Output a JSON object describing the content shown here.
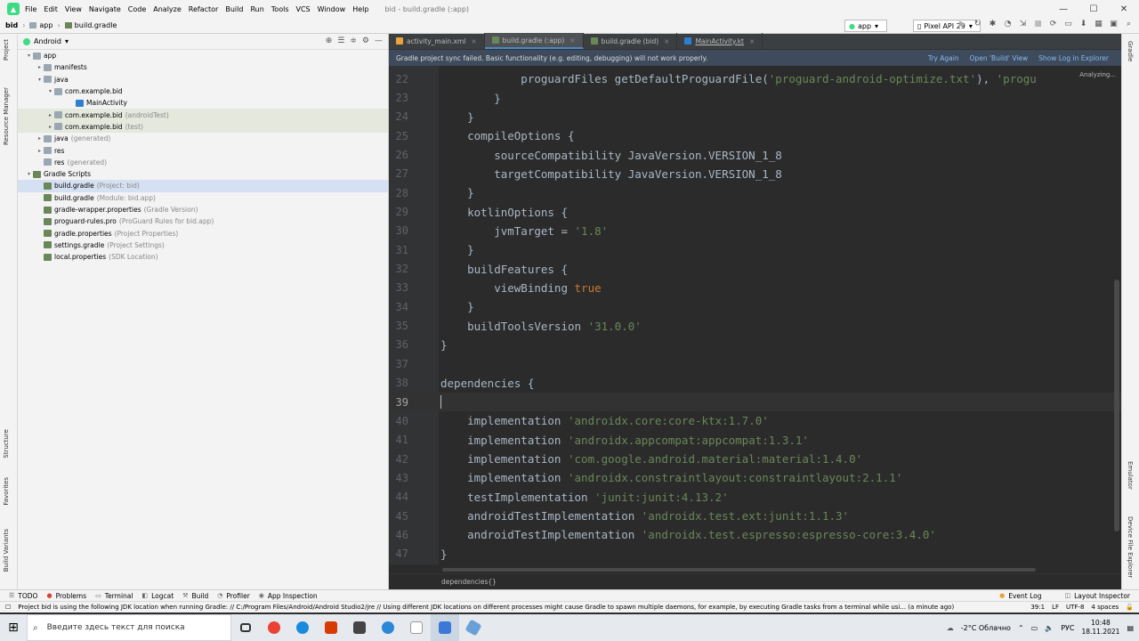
{
  "window": {
    "title": "bid - build.gradle (:app)",
    "menu": [
      "File",
      "Edit",
      "View",
      "Navigate",
      "Code",
      "Analyze",
      "Refactor",
      "Build",
      "Run",
      "Tools",
      "VCS",
      "Window",
      "Help"
    ]
  },
  "navbar": {
    "breadcrumbs": [
      "bid",
      "app",
      "build.gradle"
    ],
    "run_config": "app",
    "device": "Pixel API 29"
  },
  "left_strip": [
    "Project",
    "Resource Manager",
    "Structure",
    "Favorites",
    "Build Variants"
  ],
  "right_strip": [
    "Gradle",
    "Emulator",
    "Device File Explorer"
  ],
  "project": {
    "view": "Android",
    "tree": [
      {
        "label": "app",
        "dim": "",
        "depth": 0,
        "arrow": "▾",
        "icon": "folder"
      },
      {
        "label": "manifests",
        "dim": "",
        "depth": 1,
        "arrow": "▸",
        "icon": "folder"
      },
      {
        "label": "java",
        "dim": "",
        "depth": 1,
        "arrow": "▾",
        "icon": "folder"
      },
      {
        "label": "com.example.bid",
        "dim": "",
        "depth": 2,
        "arrow": "▾",
        "icon": "pkg"
      },
      {
        "label": "MainActivity",
        "dim": "",
        "depth": 4,
        "arrow": "",
        "icon": "kt"
      },
      {
        "label": "com.example.bid",
        "dim": "(androidTest)",
        "depth": 2,
        "arrow": "▸",
        "icon": "pkg"
      },
      {
        "label": "com.example.bid",
        "dim": "(test)",
        "depth": 2,
        "arrow": "▸",
        "icon": "pkg"
      },
      {
        "label": "java",
        "dim": "(generated)",
        "depth": 1,
        "arrow": "▸",
        "icon": "folder"
      },
      {
        "label": "res",
        "dim": "",
        "depth": 1,
        "arrow": "▸",
        "icon": "folder"
      },
      {
        "label": "res",
        "dim": "(generated)",
        "depth": 1,
        "arrow": "",
        "icon": "folder"
      },
      {
        "label": "Gradle Scripts",
        "dim": "",
        "depth": 0,
        "arrow": "▾",
        "icon": "gfile"
      },
      {
        "label": "build.gradle",
        "dim": "(Project: bid)",
        "depth": 1,
        "arrow": "",
        "icon": "gfile"
      },
      {
        "label": "build.gradle",
        "dim": "(Module: bid.app)",
        "depth": 1,
        "arrow": "",
        "icon": "gfile"
      },
      {
        "label": "gradle-wrapper.properties",
        "dim": "(Gradle Version)",
        "depth": 1,
        "arrow": "",
        "icon": "gfile"
      },
      {
        "label": "proguard-rules.pro",
        "dim": "(ProGuard Rules for bid.app)",
        "depth": 1,
        "arrow": "",
        "icon": "gfile"
      },
      {
        "label": "gradle.properties",
        "dim": "(Project Properties)",
        "depth": 1,
        "arrow": "",
        "icon": "gfile"
      },
      {
        "label": "settings.gradle",
        "dim": "(Project Settings)",
        "depth": 1,
        "arrow": "",
        "icon": "gfile"
      },
      {
        "label": "local.properties",
        "dim": "(SDK Location)",
        "depth": 1,
        "arrow": "",
        "icon": "gfile"
      }
    ],
    "selected_index": 11,
    "highlighted_indices": [
      5,
      6
    ]
  },
  "tabs": [
    {
      "label": "activity_main.xml",
      "active": false
    },
    {
      "label": "build.gradle (:app)",
      "active": true
    },
    {
      "label": "build.gradle (bid)",
      "active": false
    },
    {
      "label": "MainActivity.kt",
      "active": false
    }
  ],
  "banner": {
    "text": "Gradle project sync failed. Basic functionality (e.g. editing, debugging) will not work properly.",
    "links": [
      "Try Again",
      "Open 'Build' View",
      "Show Log in Explorer"
    ]
  },
  "analyzing": "Analyzing...",
  "code_lines": [
    {
      "n": "22",
      "parts": [
        [
          "code",
          "            proguardFiles getDefaultProguardFile("
        ],
        [
          "str",
          "'proguard-android-optimize.txt'"
        ],
        [
          "code",
          "), "
        ],
        [
          "str",
          "'progu"
        ]
      ]
    },
    {
      "n": "23",
      "parts": [
        [
          "code",
          "        }"
        ]
      ]
    },
    {
      "n": "24",
      "parts": [
        [
          "code",
          "    }"
        ]
      ]
    },
    {
      "n": "25",
      "parts": [
        [
          "code",
          "    compileOptions {"
        ]
      ]
    },
    {
      "n": "26",
      "parts": [
        [
          "code",
          "        sourceCompatibility JavaVersion.VERSION_1_8"
        ]
      ]
    },
    {
      "n": "27",
      "parts": [
        [
          "code",
          "        targetCompatibility JavaVersion.VERSION_1_8"
        ]
      ]
    },
    {
      "n": "28",
      "parts": [
        [
          "code",
          "    }"
        ]
      ]
    },
    {
      "n": "29",
      "parts": [
        [
          "code",
          "    kotlinOptions {"
        ]
      ]
    },
    {
      "n": "30",
      "parts": [
        [
          "code",
          "        jvmTarget = "
        ],
        [
          "str",
          "'1.8'"
        ]
      ]
    },
    {
      "n": "31",
      "parts": [
        [
          "code",
          "    }"
        ]
      ]
    },
    {
      "n": "32",
      "parts": [
        [
          "code",
          "    buildFeatures {"
        ]
      ]
    },
    {
      "n": "33",
      "parts": [
        [
          "code",
          "        viewBinding "
        ],
        [
          "kw",
          "true"
        ]
      ]
    },
    {
      "n": "34",
      "parts": [
        [
          "code",
          "    }"
        ]
      ]
    },
    {
      "n": "35",
      "parts": [
        [
          "code",
          "    buildToolsVersion "
        ],
        [
          "str",
          "'31.0.0'"
        ]
      ]
    },
    {
      "n": "36",
      "parts": [
        [
          "code",
          "}"
        ]
      ]
    },
    {
      "n": "37",
      "parts": []
    },
    {
      "n": "38",
      "parts": [
        [
          "code",
          "dependencies {"
        ]
      ]
    },
    {
      "n": "39",
      "parts": [],
      "current": true
    },
    {
      "n": "40",
      "parts": [
        [
          "code",
          "    implementation "
        ],
        [
          "str",
          "'androidx.core:core-ktx:1.7.0'"
        ]
      ]
    },
    {
      "n": "41",
      "parts": [
        [
          "code",
          "    implementation "
        ],
        [
          "str",
          "'androidx.appcompat:appcompat:1.3.1'"
        ]
      ]
    },
    {
      "n": "42",
      "parts": [
        [
          "code",
          "    implementation "
        ],
        [
          "str",
          "'com.google.android.material:material:1.4.0'"
        ]
      ]
    },
    {
      "n": "43",
      "parts": [
        [
          "code",
          "    implementation "
        ],
        [
          "str",
          "'androidx.constraintlayout:constraintlayout:2.1.1'"
        ]
      ]
    },
    {
      "n": "44",
      "parts": [
        [
          "code",
          "    testImplementation "
        ],
        [
          "str",
          "'junit:junit:4.13.2'"
        ]
      ]
    },
    {
      "n": "45",
      "parts": [
        [
          "code",
          "    androidTestImplementation "
        ],
        [
          "str",
          "'androidx.test.ext:junit:1.1.3'"
        ]
      ]
    },
    {
      "n": "46",
      "parts": [
        [
          "code",
          "    androidTestImplementation "
        ],
        [
          "str",
          "'androidx.test.espresso:espresso-core:3.4.0'"
        ]
      ]
    },
    {
      "n": "47",
      "parts": [
        [
          "code",
          "}"
        ]
      ]
    }
  ],
  "editor_breadcrumb": "dependencies{}",
  "toolwindows": {
    "left": [
      "TODO",
      "Problems",
      "Terminal",
      "Logcat",
      "Build",
      "Profiler",
      "App Inspection"
    ],
    "right": [
      "Event Log",
      "Layout Inspector"
    ]
  },
  "status": {
    "message": "Project bid is using the following JDK location when running Gradle: // C:/Program Files/Android/Android Studio2/jre // Using different JDK locations on different processes might cause Gradle to spawn multiple daemons, for example, by executing Gradle tasks from a terminal while usi... (a minute ago)",
    "position": "39:1",
    "line_sep": "LF",
    "encoding": "UTF-8",
    "indent": "4 spaces"
  },
  "taskbar": {
    "search_placeholder": "Введите здесь текст для поиска",
    "weather": "-2°C  Облачно",
    "lang": "РУС",
    "time": "10:48",
    "date": "18.11.2021"
  }
}
